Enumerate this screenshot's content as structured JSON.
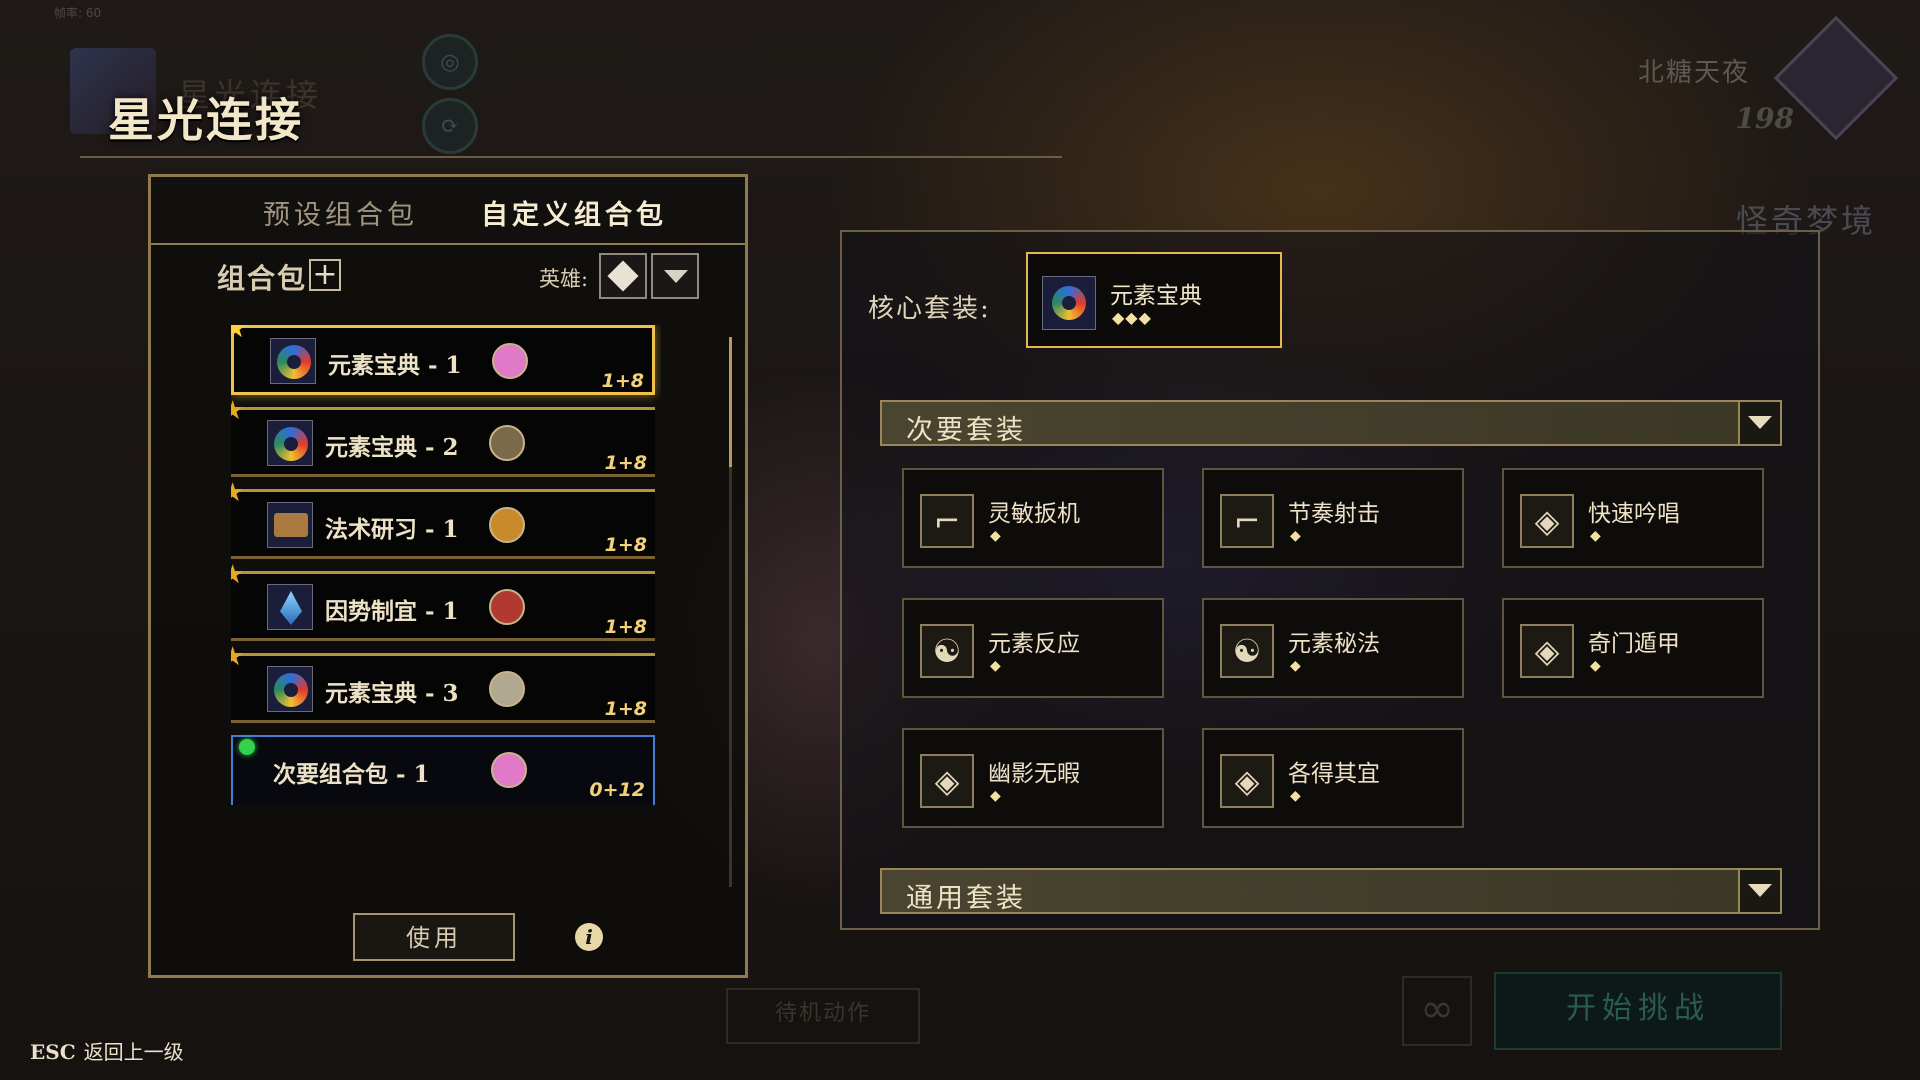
{
  "fps": "帧率: 60",
  "header": {
    "title": "星光连接",
    "ghost_title": "星光连接"
  },
  "user": {
    "name": "北糖天夜",
    "level": "198",
    "realm": "怪奇梦境"
  },
  "left_panel": {
    "tabs": [
      "预设组合包",
      "自定义组合包"
    ],
    "active_tab": "自定义组合包",
    "pack_label": "组合包",
    "hero_label": "英雄:",
    "packs": [
      {
        "name": "元素宝典 - 1",
        "count": "1+8",
        "icon": "swirl-icon",
        "avatar_color": "#e07ac8",
        "selected": true
      },
      {
        "name": "元素宝典 - 2",
        "count": "1+8",
        "icon": "swirl-icon",
        "avatar_color": "#7a6a4a",
        "selected": false
      },
      {
        "name": "法术研习 - 1",
        "count": "1+8",
        "icon": "tome-icon",
        "avatar_color": "#c88a2a",
        "selected": false
      },
      {
        "name": "因势制宜 - 1",
        "count": "1+8",
        "icon": "crystal-icon",
        "avatar_color": "#b03a30",
        "selected": false
      },
      {
        "name": "元素宝典 - 3",
        "count": "1+8",
        "icon": "swirl-icon",
        "avatar_color": "#b0a890",
        "selected": false
      },
      {
        "name": "次要组合包 - 1",
        "count": "0+12",
        "icon": "",
        "avatar_color": "#e07ac8",
        "selected": false
      }
    ],
    "use_label": "使用",
    "info_label": "i"
  },
  "right_panel": {
    "core_label": "核心套装:",
    "core_set": {
      "name": "元素宝典",
      "rating": "◆◆◆"
    },
    "secondary_header": "次要套装",
    "general_header": "通用套装",
    "secondary_sets": [
      {
        "name": "灵敏扳机",
        "rating": "◆",
        "icon": "pistol-icon",
        "glyph": "⌐"
      },
      {
        "name": "节奏射击",
        "rating": "◆",
        "icon": "pistol-icon",
        "glyph": "⌐"
      },
      {
        "name": "快速吟唱",
        "rating": "◆",
        "icon": "rune-icon",
        "glyph": "◈"
      },
      {
        "name": "元素反应",
        "rating": "◆",
        "icon": "triskelion-icon",
        "glyph": "☯"
      },
      {
        "name": "元素秘法",
        "rating": "◆",
        "icon": "triskelion-icon",
        "glyph": "☯"
      },
      {
        "name": "奇门遁甲",
        "rating": "◆",
        "icon": "diamond-icon",
        "glyph": "◈"
      },
      {
        "name": "幽影无暇",
        "rating": "◆",
        "icon": "diamond-icon",
        "glyph": "◈"
      },
      {
        "name": "各得其宜",
        "rating": "◆",
        "icon": "diamond-icon",
        "glyph": "◈"
      }
    ]
  },
  "background": {
    "idle_action": "待机动作",
    "start_challenge": "开始挑战",
    "infinity_glyph": "∞"
  },
  "footer": {
    "esc_key": "ESC",
    "esc_label": "返回上一级"
  }
}
